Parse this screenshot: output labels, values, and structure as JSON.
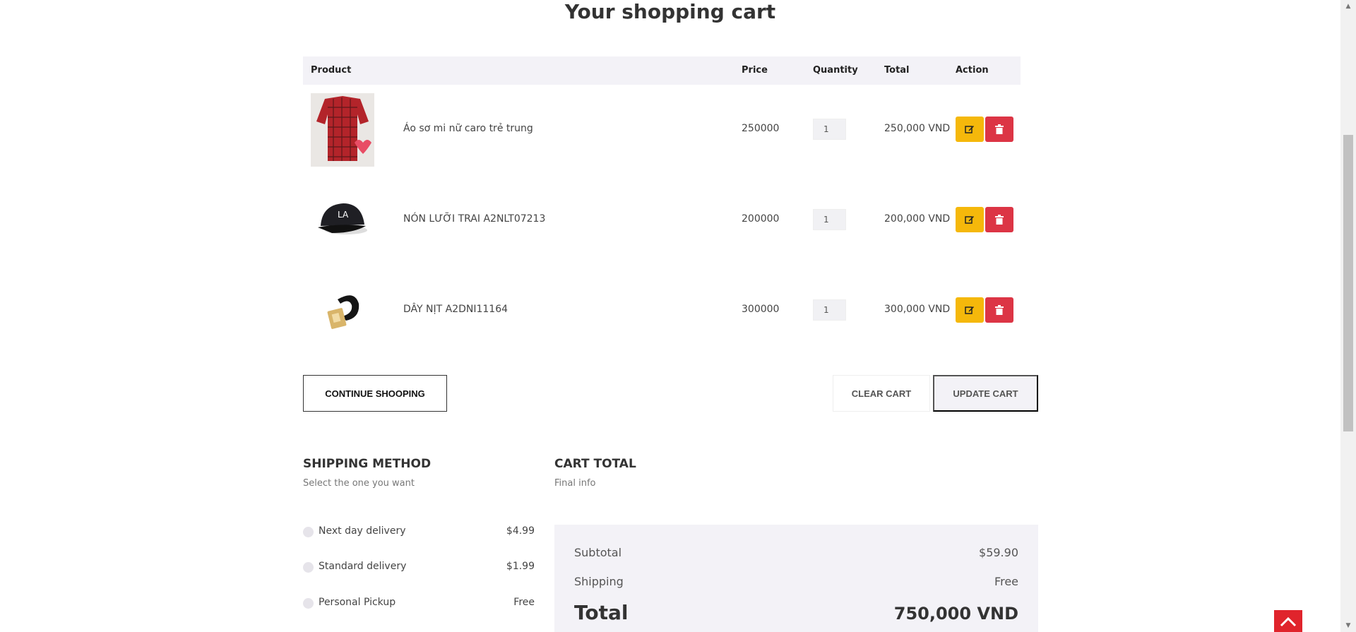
{
  "page_title": "Your shopping cart",
  "table": {
    "headers": {
      "product": "Product",
      "price": "Price",
      "quantity": "Quantity",
      "total": "Total",
      "action": "Action"
    },
    "rows": [
      {
        "name": "Áo sơ mi nữ caro trẻ trung",
        "price": "250000",
        "quantity": "1",
        "total": "250,000 VND",
        "image": "red-plaid-shirt"
      },
      {
        "name": "NÓN LƯỠI TRAI A2NLT07213",
        "price": "200000",
        "quantity": "1",
        "total": "200,000 VND",
        "image": "black-cap"
      },
      {
        "name": "DÂY NỊT A2DNI11164",
        "price": "300000",
        "quantity": "1",
        "total": "300,000 VND",
        "image": "black-belt"
      }
    ],
    "edit_icon": "edit-icon",
    "delete_icon": "trash-icon"
  },
  "buttons": {
    "continue": "CONTINUE SHOOPING",
    "clear": "CLEAR CART",
    "update": "UPDATE CART"
  },
  "shipping": {
    "title": "SHIPPING METHOD",
    "subtitle": "Select the one you want",
    "options": [
      {
        "label": "Next day delivery",
        "price": "$4.99"
      },
      {
        "label": "Standard delivery",
        "price": "$1.99"
      },
      {
        "label": "Personal Pickup",
        "price": "Free"
      }
    ]
  },
  "cart_total": {
    "title": "CART TOTAL",
    "subtitle": "Final info",
    "subtotal_label": "Subtotal",
    "subtotal_value": "$59.90",
    "shipping_label": "Shipping",
    "shipping_value": "Free",
    "total_label": "Total",
    "total_value": "750,000 VND"
  },
  "colors": {
    "edit_button": "#f5b80b",
    "delete_button": "#dc3545",
    "back_to_top": "#e0242c",
    "panel_bg": "#f3f2f7"
  }
}
